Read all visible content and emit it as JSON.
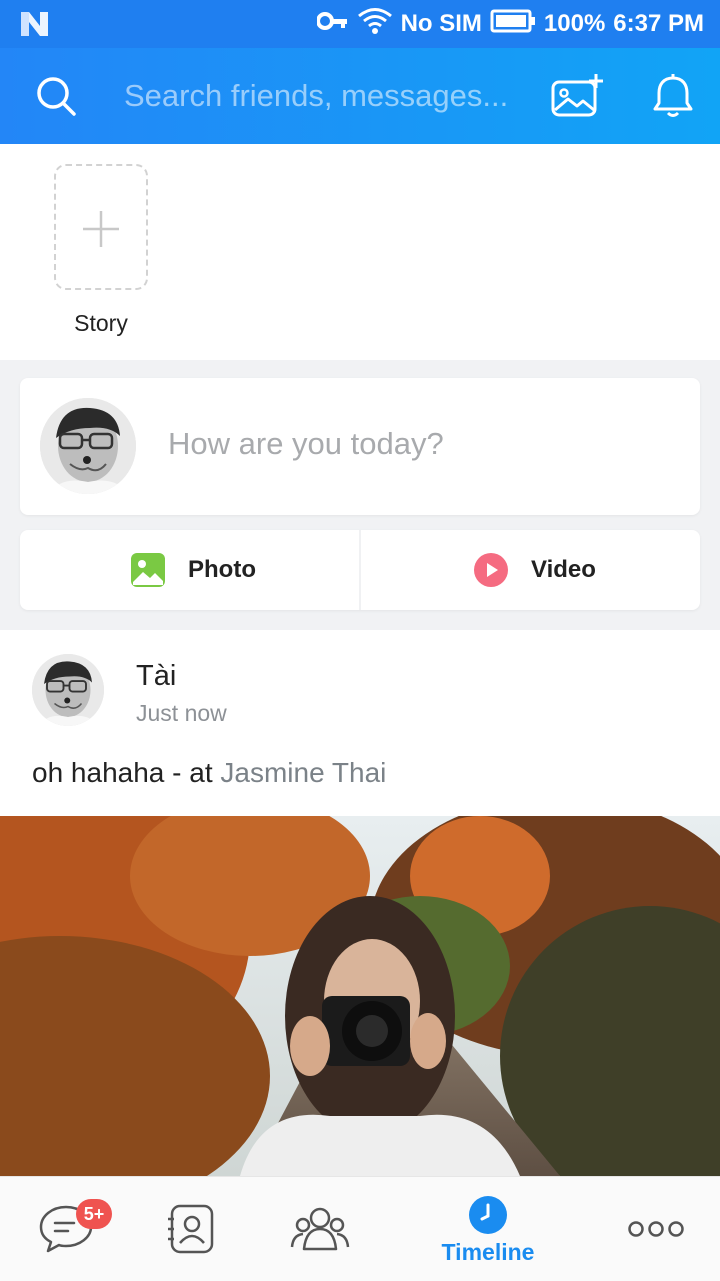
{
  "status_bar": {
    "carrier_text": "No SIM",
    "battery_percent": "100%",
    "time": "6:37 PM",
    "icons": [
      "n-logo-icon",
      "vpn-key-icon",
      "wifi-icon",
      "battery-icon"
    ]
  },
  "search": {
    "placeholder": "Search friends, messages..."
  },
  "story": {
    "label": "Story"
  },
  "compose": {
    "prompt": "How are you today?"
  },
  "media_actions": {
    "photo_label": "Photo",
    "video_label": "Video"
  },
  "post": {
    "author": "Tài",
    "time": "Just now",
    "text": "oh hahaha - at ",
    "location": "Jasmine Thai"
  },
  "bottom_nav": {
    "messages_badge": "5+",
    "timeline_label": "Timeline",
    "active_tab": "Timeline"
  },
  "colors": {
    "accent": "#1a8cf0",
    "header_gradient_start": "#2386f7",
    "header_gradient_end": "#11a4f6",
    "badge_red": "#ef5350",
    "photo_green": "#7ac943",
    "video_red": "#f56b81"
  }
}
